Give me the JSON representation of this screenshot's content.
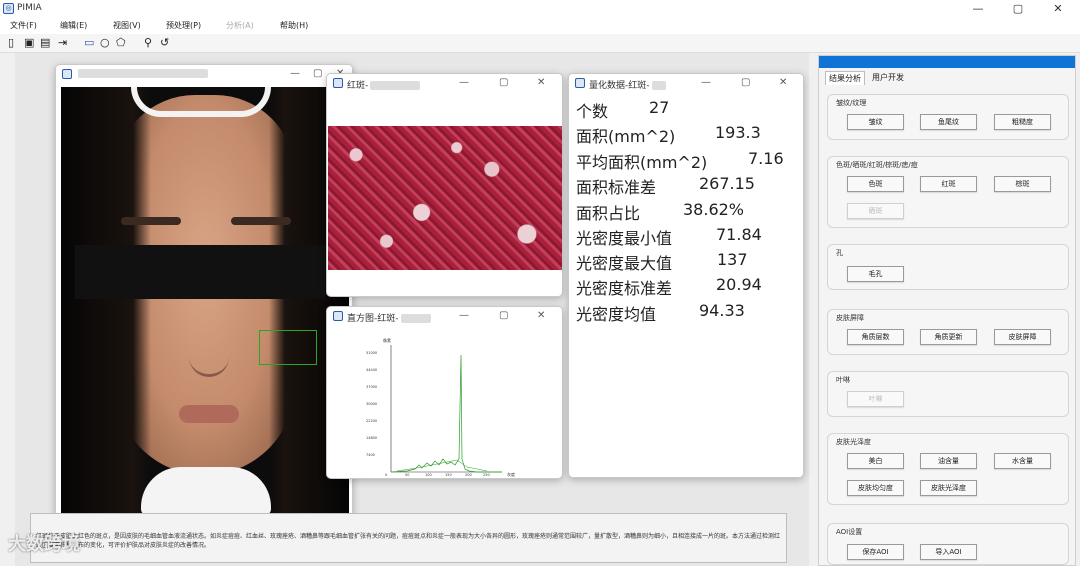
{
  "app": {
    "title": "PIMIA",
    "icon": "app-logo-icon"
  },
  "window_controls": {
    "minimize": "—",
    "maximize": "▢",
    "close": "✕"
  },
  "menu": [
    {
      "label": "文件(F)",
      "disabled": false
    },
    {
      "label": "编辑(E)",
      "disabled": false
    },
    {
      "label": "视图(V)",
      "disabled": false
    },
    {
      "label": "预处理(P)",
      "disabled": false
    },
    {
      "label": "分析(A)",
      "disabled": true
    },
    {
      "label": "帮助(H)",
      "disabled": false
    }
  ],
  "toolbar": [
    "open-icon",
    "save-icon",
    "save-as-icon",
    "export-icon",
    "rect-select-icon",
    "ellipse-select-icon",
    "polygon-select-icon",
    "zoom-icon",
    "undo-icon"
  ],
  "face_window": {
    "title": ""
  },
  "red_window": {
    "title": "红斑-"
  },
  "hist_window": {
    "title": "直方图-红斑-",
    "ylabel": "像素",
    "xlabel": "灰度",
    "yticks": [
      "51000",
      "44440",
      "37000",
      "30000",
      "22200",
      "14800",
      "7400",
      "0"
    ],
    "xticks": [
      "0",
      "50",
      "100",
      "150",
      "200",
      "250"
    ]
  },
  "quant_window": {
    "title": "量化数据-红斑-",
    "rows": [
      {
        "label": "个数",
        "value": "27"
      },
      {
        "label": "面积(mm^2)",
        "value": "193.3"
      },
      {
        "label": "平均面积(mm^2)",
        "value": "7.16"
      },
      {
        "label": "面积标准差",
        "value": "267.15"
      },
      {
        "label": "面积占比",
        "value": "38.62%"
      },
      {
        "label": "光密度最小值",
        "value": "71.84"
      },
      {
        "label": "光密度最大值",
        "value": "137"
      },
      {
        "label": "光密度标准差",
        "value": "20.94"
      },
      {
        "label": "光密度均值",
        "value": "94.33"
      }
    ]
  },
  "description": "红斑位于皮肤上红色的斑点，是因皮肤的毛细血管血液流通状态。如炎症痘痘、红血丝、玫瑰痤疮、酒糟鼻等跟毛细血管扩张有关的问题，痘痘斑点和炎症一般表现为大小各异的圆形，玫瑰痤疮则通常范围较广，量扩散型，酒糟鼻则为细小，且相连接成一片的斑。本方法通过检测红斑区域面积和分布的变化，可评价护肤品对皮肤炎症的改善情况。",
  "watermark": "大数跨境",
  "right_panel": {
    "tabs": [
      "结果分析",
      "用户开发"
    ],
    "groups": [
      {
        "title": "皱纹/纹理",
        "buttons": [
          {
            "label": "皱纹",
            "disabled": false
          },
          {
            "label": "鱼尾纹",
            "disabled": false
          },
          {
            "label": "粗糙度",
            "disabled": false
          }
        ]
      },
      {
        "title": "色斑/晒斑/红斑/棕斑/痣/痘",
        "buttons": [
          {
            "label": "色斑",
            "disabled": false
          },
          {
            "label": "红斑",
            "disabled": false
          },
          {
            "label": "棕斑",
            "disabled": false
          },
          {
            "label": "晒斑",
            "disabled": true
          }
        ]
      },
      {
        "title": "孔",
        "buttons": [
          {
            "label": "毛孔",
            "disabled": false
          }
        ]
      },
      {
        "title": "皮肤屏障",
        "buttons": [
          {
            "label": "角质层数",
            "disabled": false
          },
          {
            "label": "角质更新",
            "disabled": false
          },
          {
            "label": "皮肤屏障",
            "disabled": false
          }
        ]
      },
      {
        "title": "叶啉",
        "buttons": [
          {
            "label": "叶啉",
            "disabled": true
          }
        ]
      },
      {
        "title": "皮肤光泽度",
        "buttons": [
          {
            "label": "美白",
            "disabled": false
          },
          {
            "label": "油含量",
            "disabled": false
          },
          {
            "label": "水含量",
            "disabled": false
          },
          {
            "label": "皮肤均匀度",
            "disabled": false
          },
          {
            "label": "皮肤光泽度",
            "disabled": false
          }
        ]
      },
      {
        "title": "AOI设置",
        "buttons": [
          {
            "label": "保存AOI",
            "disabled": false
          },
          {
            "label": "导入AOI",
            "disabled": false
          }
        ]
      }
    ]
  }
}
